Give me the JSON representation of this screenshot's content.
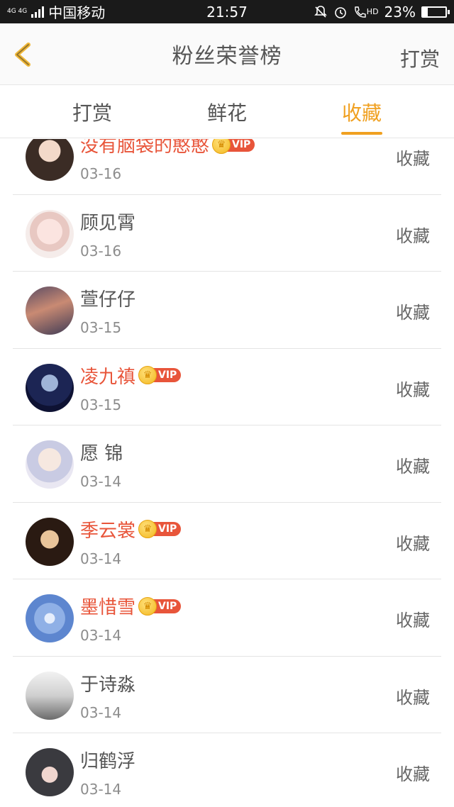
{
  "status_bar": {
    "network_top": "4G 4G",
    "carrier": "中国移动",
    "time": "21:57",
    "hd_label": "HD",
    "battery": "23%",
    "battery_level": 0.23
  },
  "header": {
    "title": "粉丝荣誉榜",
    "action": "打赏"
  },
  "tabs": [
    {
      "label": "打赏",
      "active": false
    },
    {
      "label": "鲜花",
      "active": false
    },
    {
      "label": "收藏",
      "active": true
    }
  ],
  "vip_label": "VIP",
  "accent_color": "#f0a020",
  "vip_color": "#e8553a",
  "rows": [
    {
      "name": "没有脑袋的憨憨",
      "vip": true,
      "date": "03-16",
      "action": "收藏"
    },
    {
      "name": "顾见霄",
      "vip": false,
      "date": "03-16",
      "action": "收藏"
    },
    {
      "name": "萱仔仔",
      "vip": false,
      "date": "03-15",
      "action": "收藏"
    },
    {
      "name": "凌九禛",
      "vip": true,
      "date": "03-15",
      "action": "收藏"
    },
    {
      "name": "愿 锦",
      "vip": false,
      "date": "03-14",
      "action": "收藏"
    },
    {
      "name": "季云裳",
      "vip": true,
      "date": "03-14",
      "action": "收藏"
    },
    {
      "name": "墨惜雪",
      "vip": true,
      "date": "03-14",
      "action": "收藏"
    },
    {
      "name": "于诗淼",
      "vip": false,
      "date": "03-14",
      "action": "收藏"
    },
    {
      "name": "归鹤浮",
      "vip": false,
      "date": "03-14",
      "action": "收藏"
    }
  ]
}
